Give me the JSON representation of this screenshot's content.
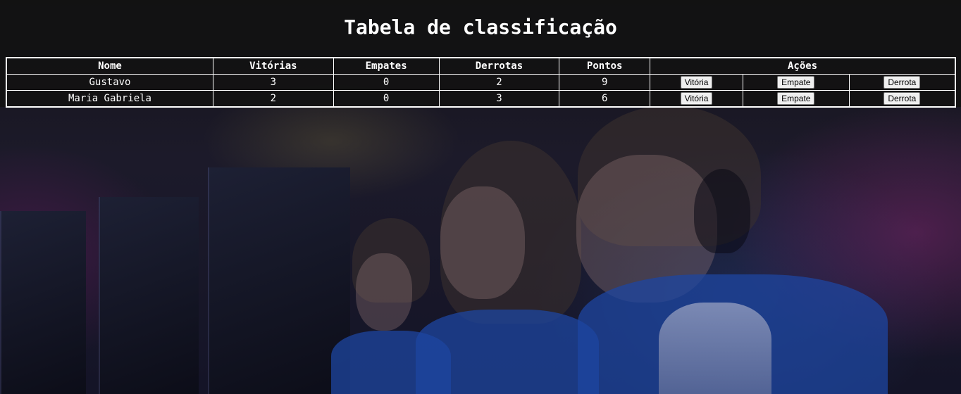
{
  "page": {
    "title": "Tabela de classificação"
  },
  "table": {
    "headers": [
      "Nome",
      "Vitórias",
      "Empates",
      "Derrotas",
      "Pontos",
      "Ações"
    ],
    "rows": [
      {
        "nome": "Gustavo",
        "vitorias": "3",
        "empates": "0",
        "derrotas": "2",
        "pontos": "9",
        "actions": [
          "Vitória",
          "Empate",
          "Derrota"
        ]
      },
      {
        "nome": "Maria Gabriela",
        "vitorias": "2",
        "empates": "0",
        "derrotas": "3",
        "pontos": "6",
        "actions": [
          "Vitória",
          "Empate",
          "Derrota"
        ]
      }
    ]
  },
  "colors": {
    "background": "#121212",
    "text": "#ffffff",
    "border": "#ffffff",
    "button_bg": "#efefef"
  }
}
